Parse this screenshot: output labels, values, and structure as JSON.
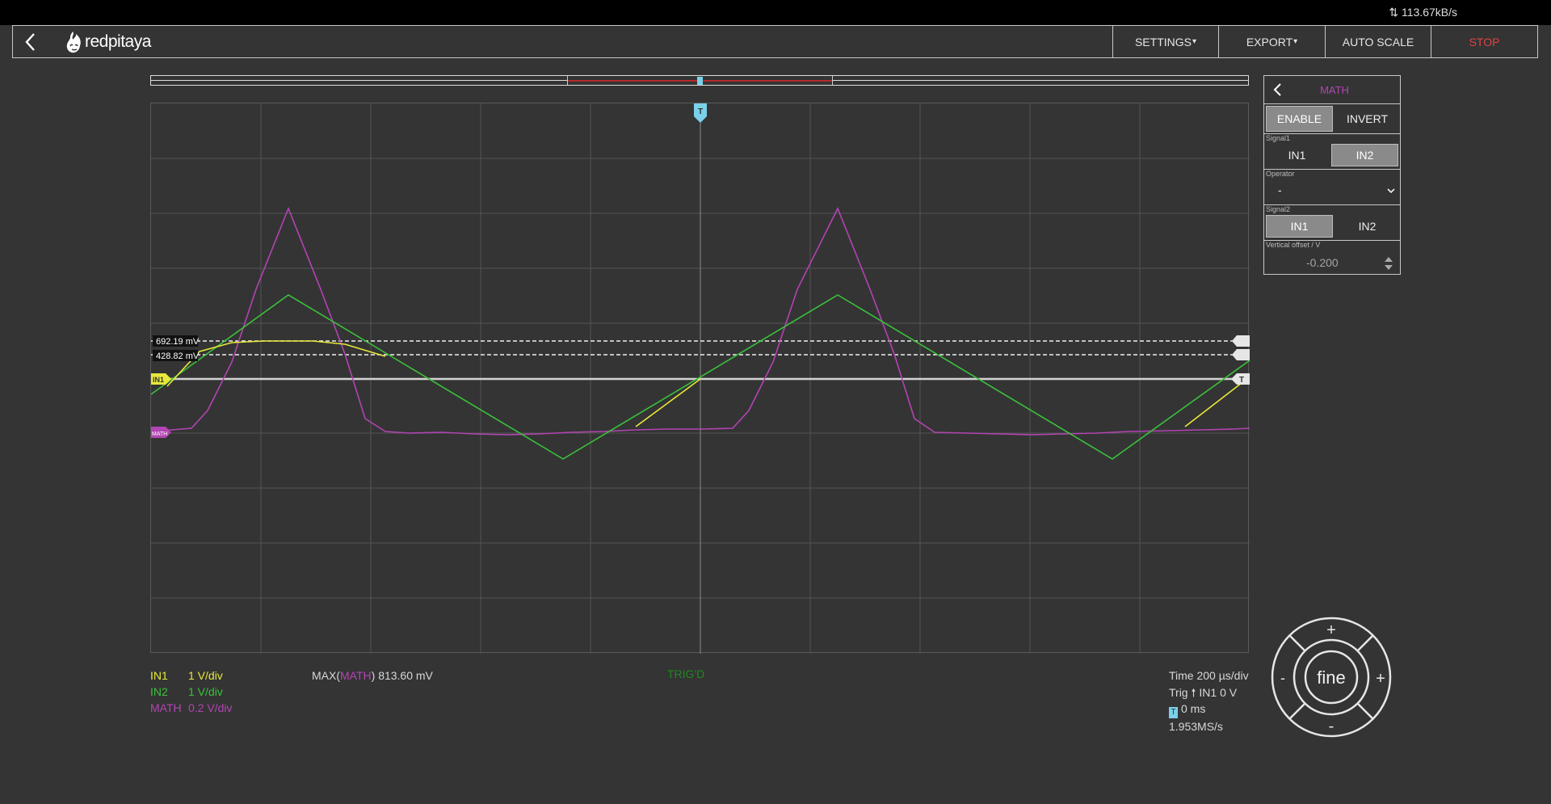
{
  "status": {
    "data_rate": "113.67kB/s"
  },
  "header": {
    "brand": "redpitaya",
    "menu": [
      {
        "label": "SETTINGS",
        "dropdown": true
      },
      {
        "label": "EXPORT",
        "dropdown": true
      },
      {
        "label": "AUTO SCALE",
        "dropdown": false
      },
      {
        "label": "STOP",
        "dropdown": false
      }
    ]
  },
  "plot": {
    "cursor_labels": [
      "692.19 mV",
      "428.82 mV"
    ],
    "markers": {
      "in1": "IN1",
      "math": "MATH",
      "trigger": "T"
    }
  },
  "legend": {
    "channels": [
      {
        "name": "IN1",
        "scale": "1 V/div"
      },
      {
        "name": "IN2",
        "scale": "1 V/div"
      },
      {
        "name": "MATH",
        "scale": "0.2 V/div"
      }
    ],
    "measure": {
      "func_prefix": "MAX(",
      "func_channel": "MATH",
      "func_suffix": ")",
      "value": "813.60 mV"
    },
    "trig_status": "TRIG'D"
  },
  "timebase": {
    "time": "Time 200 µs/div",
    "trig_prefix": "Trig",
    "trig_source": "IN1 0 V",
    "trigger_marker": "T",
    "offset": "0 ms",
    "sample_rate": "1.953MS/s"
  },
  "math_panel": {
    "title": "MATH",
    "enable_label": "ENABLE",
    "invert_label": "INVERT",
    "signal1_label": "Signal1",
    "signal1_options": [
      "IN1",
      "IN2"
    ],
    "signal1_selected": "IN2",
    "operator_label": "Operator",
    "operator_value": "-",
    "signal2_label": "Signal2",
    "signal2_options": [
      "IN1",
      "IN2"
    ],
    "signal2_selected": "IN1",
    "offset_label": "Vertical offset / V",
    "offset_value": "-0.200"
  },
  "dpad": {
    "center_label": "fine",
    "up": "+",
    "down": "-",
    "left": "-",
    "right": "+"
  },
  "colors": {
    "in1": "#e8e83a",
    "in2": "#3ac13a",
    "math": "#b344b3",
    "trigger": "#7ad1ea",
    "stop": "#e24141"
  },
  "icons": [
    "back-icon",
    "redpitaya-logo-icon",
    "upload-download-icon",
    "chevron-down-icon",
    "spin-arrows-icon"
  ]
}
